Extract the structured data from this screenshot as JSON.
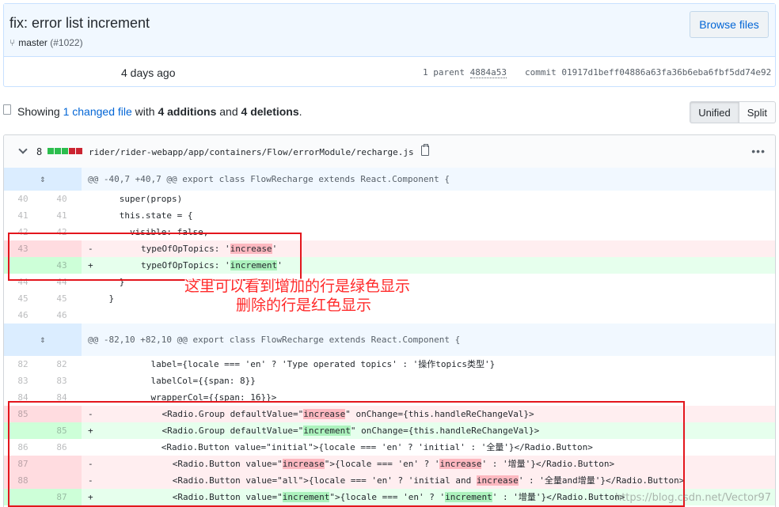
{
  "commit": {
    "title": "fix: error list increment",
    "branch": "master",
    "pr": "(#1022)",
    "browse_label": "Browse files",
    "time": "4 days ago",
    "parent_label": "1 parent",
    "parent_sha": "4884a53",
    "commit_label": "commit",
    "commit_sha": "01917d1beff04886a63fa36b6eba6fbf5dd74e92"
  },
  "toc": {
    "showing": "Showing",
    "changed": "1 changed file",
    "with": "with",
    "additions": "4 additions",
    "and": "and",
    "deletions": "4 deletions",
    "period": ".",
    "unified_label": "Unified",
    "split_label": "Split"
  },
  "file": {
    "stat": "8",
    "path": "rider/rider-webapp/app/containers/Flow/errorModule/recharge.js",
    "menu": "•••",
    "diffstat": [
      "add",
      "add",
      "add",
      "del",
      "del"
    ]
  },
  "hunks": {
    "h1": "@@ -40,7 +40,7 @@ export class FlowRecharge extends React.Component {",
    "h2": "@@ -82,10 +82,10 @@ export class FlowRecharge extends React.Component {"
  },
  "lines": {
    "l40": {
      "o": "40",
      "n": "40",
      "code": "      super(props)"
    },
    "l41": {
      "o": "41",
      "n": "41",
      "code": "      this.state = {"
    },
    "l42": {
      "o": "42",
      "n": "42",
      "code": "        visible: false,"
    },
    "l43d": {
      "o": "43",
      "n": "",
      "sign": "-",
      "pre": "        typeOfOpTopics: '",
      "hl": "increase",
      "post": "'"
    },
    "l43a": {
      "o": "",
      "n": "43",
      "sign": "+",
      "pre": "        typeOfOpTopics: '",
      "hl": "increment",
      "post": "'"
    },
    "l44": {
      "o": "44",
      "n": "44",
      "code": "      }"
    },
    "l45": {
      "o": "45",
      "n": "45",
      "code": "    }"
    },
    "l46": {
      "o": "46",
      "n": "46",
      "code": ""
    },
    "l82": {
      "o": "82",
      "n": "82",
      "code": "            label={locale === 'en' ? 'Type operated topics' : '操作topics类型'}"
    },
    "l83": {
      "o": "83",
      "n": "83",
      "code": "            labelCol={{span: 8}}"
    },
    "l84": {
      "o": "84",
      "n": "84",
      "code": "            wrapperCol={{span: 16}}>"
    },
    "l85d": {
      "o": "85",
      "n": "",
      "sign": "-",
      "pre": "            <Radio.Group defaultValue=\"",
      "hl": "increase",
      "post": "\" onChange={this.handleReChangeVal}>"
    },
    "l85a": {
      "o": "",
      "n": "85",
      "sign": "+",
      "pre": "            <Radio.Group defaultValue=\"",
      "hl": "increment",
      "post": "\" onChange={this.handleReChangeVal}>"
    },
    "l86": {
      "o": "86",
      "n": "86",
      "code": "              <Radio.Button value=\"initial\">{locale === 'en' ? 'initial' : '全量'}</Radio.Button>"
    },
    "l87d": {
      "o": "87",
      "n": "",
      "sign": "-",
      "pre": "              <Radio.Button value=\"",
      "hl": "increase",
      "mid": "\">{locale === 'en' ? '",
      "hl2": "increase",
      "post": "' : '增量'}</Radio.Button>"
    },
    "l88d": {
      "o": "88",
      "n": "",
      "sign": "-",
      "pre": "              <Radio.Button value=\"all\">{locale === 'en' ? 'initial and ",
      "hl": "increase",
      "post": "' : '全量and增量'}</Radio.Button>"
    },
    "l87a": {
      "o": "",
      "n": "87",
      "sign": "+",
      "pre": "              <Radio.Button value=\"",
      "hl": "increment",
      "mid": "\">{locale === 'en' ? '",
      "hl2": "increment",
      "post": "' : '增量'}</Radio.Button>"
    }
  },
  "annotation": {
    "line1": "这里可以看到增加的行是绿色显示",
    "line2": "删除的行是红色显示"
  },
  "watermark": "https://blog.csdn.net/Vector97"
}
